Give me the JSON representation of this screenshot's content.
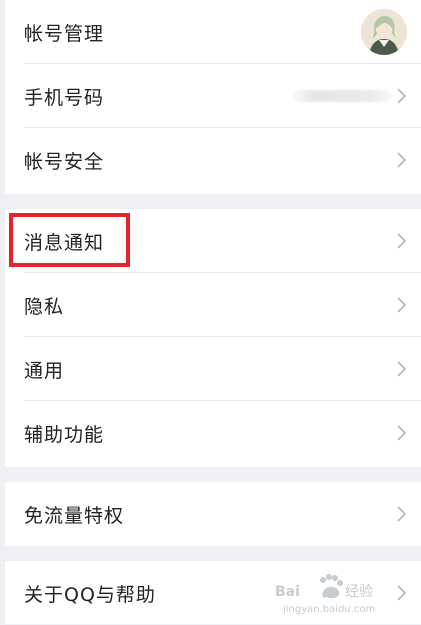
{
  "account": {
    "title": "帐号管理",
    "phone_label": "手机号码",
    "security_label": "帐号安全"
  },
  "settings": {
    "notifications_label": "消息通知",
    "privacy_label": "隐私",
    "general_label": "通用",
    "accessibility_label": "辅助功能"
  },
  "traffic": {
    "free_traffic_label": "免流量特权"
  },
  "about": {
    "about_label": "关于QQ与帮助"
  },
  "watermark": {
    "text": "Baidu 经验",
    "sub": "jingyan.baidu.com"
  },
  "colors": {
    "highlight": "#e4252c",
    "background": "#eef0f3"
  }
}
